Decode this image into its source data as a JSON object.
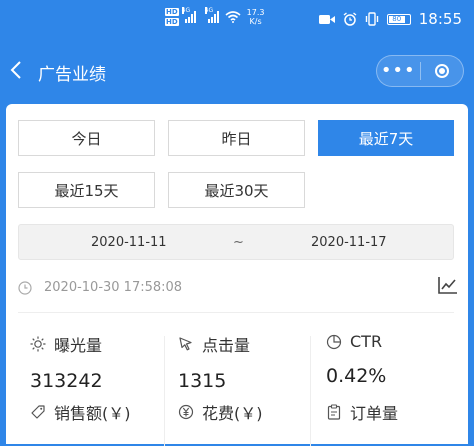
{
  "status_bar": {
    "hd1": "HD",
    "hd2": "HD",
    "sig1": "4G",
    "sig2": "4G",
    "speed_value": "17.3",
    "speed_unit": "K/s",
    "battery": "80",
    "time": "18:55"
  },
  "nav": {
    "title": "广告业绩",
    "back_icon": "chevron-left-icon",
    "more_icon": "more-dots-icon",
    "close_icon": "capsule-close-icon"
  },
  "range_buttons": [
    {
      "label": "今日",
      "active": false
    },
    {
      "label": "昨日",
      "active": false
    },
    {
      "label": "最近7天",
      "active": true
    },
    {
      "label": "最近15天",
      "active": false
    },
    {
      "label": "最近30天",
      "active": false
    }
  ],
  "date_range": {
    "start": "2020-11-11",
    "separator": "~",
    "end": "2020-11-17"
  },
  "updated_time": "2020-10-30 17:58:08",
  "metrics": [
    {
      "label": "曝光量",
      "value": "313242",
      "icon": "sun-icon"
    },
    {
      "label": "点击量",
      "value": "1315",
      "icon": "cursor-click-icon"
    },
    {
      "label": "CTR",
      "value": "0.42%",
      "icon": "pie-chart-icon"
    },
    {
      "label": "销售额(￥)",
      "value": "",
      "icon": "tag-icon"
    },
    {
      "label": "花费(￥)",
      "value": "",
      "icon": "yen-circle-icon"
    },
    {
      "label": "订单量",
      "value": "",
      "icon": "clipboard-icon"
    }
  ],
  "colors": {
    "primary": "#2f86e8",
    "muted": "#999999"
  }
}
